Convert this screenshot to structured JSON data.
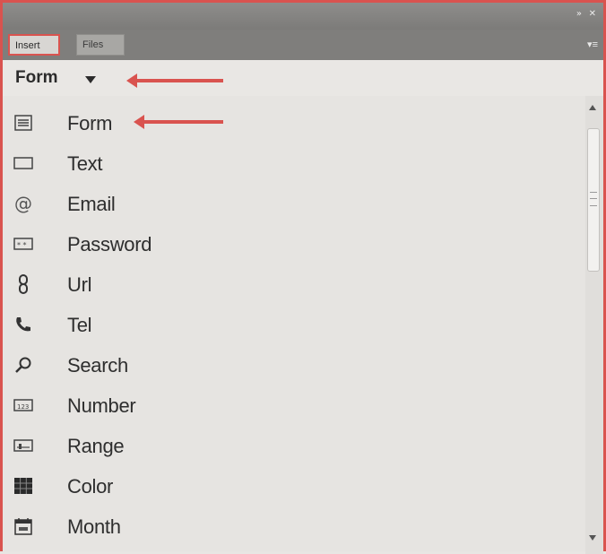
{
  "titlebar": {
    "collapse_glyph": "»",
    "close_glyph": "✕"
  },
  "tabs": [
    {
      "label": "Insert",
      "active": true
    },
    {
      "label": "Files",
      "active": false
    }
  ],
  "panel_menu_glyph": "▾≡",
  "category": {
    "label": "Form"
  },
  "accent_color": "#d9534f",
  "items": [
    {
      "label": "Form",
      "icon": "form-icon"
    },
    {
      "label": "Text",
      "icon": "text-field-icon"
    },
    {
      "label": "Email",
      "icon": "at-sign-icon"
    },
    {
      "label": "Password",
      "icon": "password-field-icon"
    },
    {
      "label": "Url",
      "icon": "link-icon"
    },
    {
      "label": "Tel",
      "icon": "phone-icon"
    },
    {
      "label": "Search",
      "icon": "search-icon"
    },
    {
      "label": "Number",
      "icon": "number-field-icon"
    },
    {
      "label": "Range",
      "icon": "range-icon"
    },
    {
      "label": "Color",
      "icon": "color-grid-icon"
    },
    {
      "label": "Month",
      "icon": "calendar-icon"
    }
  ]
}
